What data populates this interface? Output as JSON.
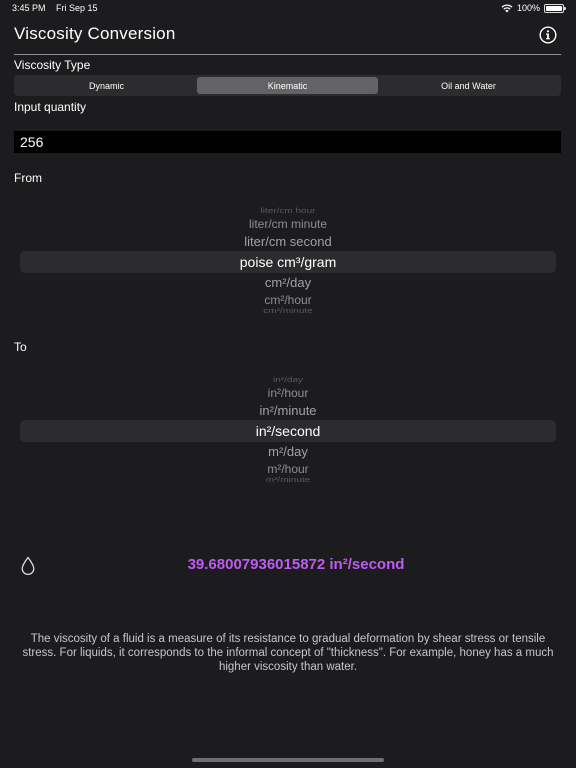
{
  "status_bar": {
    "time": "3:45 PM",
    "date": "Fri Sep 15",
    "battery": "100%"
  },
  "header": {
    "title": "Viscosity Conversion",
    "info_icon": "info-circle-icon"
  },
  "viscosity_type": {
    "label": "Viscosity Type",
    "segments": [
      "Dynamic",
      "Kinematic",
      "Oil and Water"
    ],
    "selected": "Kinematic"
  },
  "input": {
    "label": "Input quantity",
    "value": "256"
  },
  "from": {
    "label": "From",
    "items": [
      "liter/cm hour",
      "liter/cm minute",
      "liter/cm second",
      "poise cm³/gram",
      "cm²/day",
      "cm²/hour",
      "cm²/minute"
    ],
    "selected": "poise cm³/gram"
  },
  "to": {
    "label": "To",
    "items": [
      "in²/day",
      "in²/hour",
      "in²/minute",
      "in²/second",
      "m²/day",
      "m²/hour",
      "m²/minute"
    ],
    "selected": "in²/second"
  },
  "result": {
    "text": "39.68007936015872 in²/second",
    "color": "#bf5af2",
    "icon": "water-drop-icon"
  },
  "description": "The viscosity of a fluid is a measure of its resistance to gradual deformation by shear stress or tensile stress. For liquids, it corresponds to the informal concept of \"thickness\". For example, honey has a much higher viscosity than water."
}
